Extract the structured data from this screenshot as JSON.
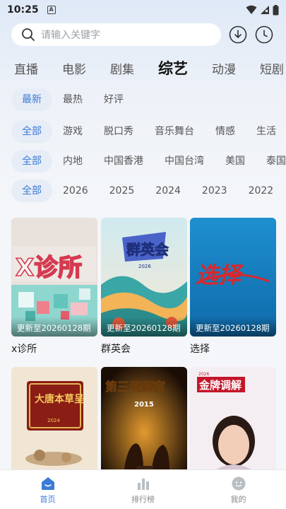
{
  "status_bar": {
    "time": "10:25",
    "a_icon": "A"
  },
  "search": {
    "placeholder": "请输入关键字"
  },
  "categories": [
    "直播",
    "电影",
    "剧集",
    "综艺",
    "动漫",
    "短剧"
  ],
  "active_category": "综艺",
  "filters": {
    "sort": [
      "最新",
      "最热",
      "好评"
    ],
    "genre": [
      "全部",
      "游戏",
      "脱口秀",
      "音乐舞台",
      "情感",
      "生活"
    ],
    "region": [
      "全部",
      "内地",
      "中国香港",
      "中国台湾",
      "美国",
      "泰国"
    ],
    "year": [
      "全部",
      "2026",
      "2025",
      "2024",
      "2023",
      "2022"
    ]
  },
  "shows": [
    {
      "title": "x诊所",
      "update": "更新至20260128期",
      "poster_text": "X诊所"
    },
    {
      "title": "群英会",
      "update": "更新至20260128期",
      "poster_text": "群英会",
      "poster_sub": "2026"
    },
    {
      "title": "选择",
      "update": "更新至20260128期",
      "poster_text": "选择"
    },
    {
      "title": "",
      "update": "",
      "poster_text": "大唐本草呈",
      "poster_sub": "2024"
    },
    {
      "title": "",
      "update": "",
      "poster_text": "第三调解室",
      "poster_sub": "2015"
    },
    {
      "title": "",
      "update": "",
      "poster_text": "金牌调解",
      "poster_sub": "2026"
    }
  ],
  "bottom_nav": [
    {
      "label": "首页",
      "icon": "home-icon",
      "active": true
    },
    {
      "label": "排行榜",
      "icon": "bar-chart-icon",
      "active": false
    },
    {
      "label": "我的",
      "icon": "profile-icon",
      "active": false
    }
  ],
  "colors": {
    "accent": "#3b7bd4",
    "chip_bg": "#e7edf6"
  }
}
